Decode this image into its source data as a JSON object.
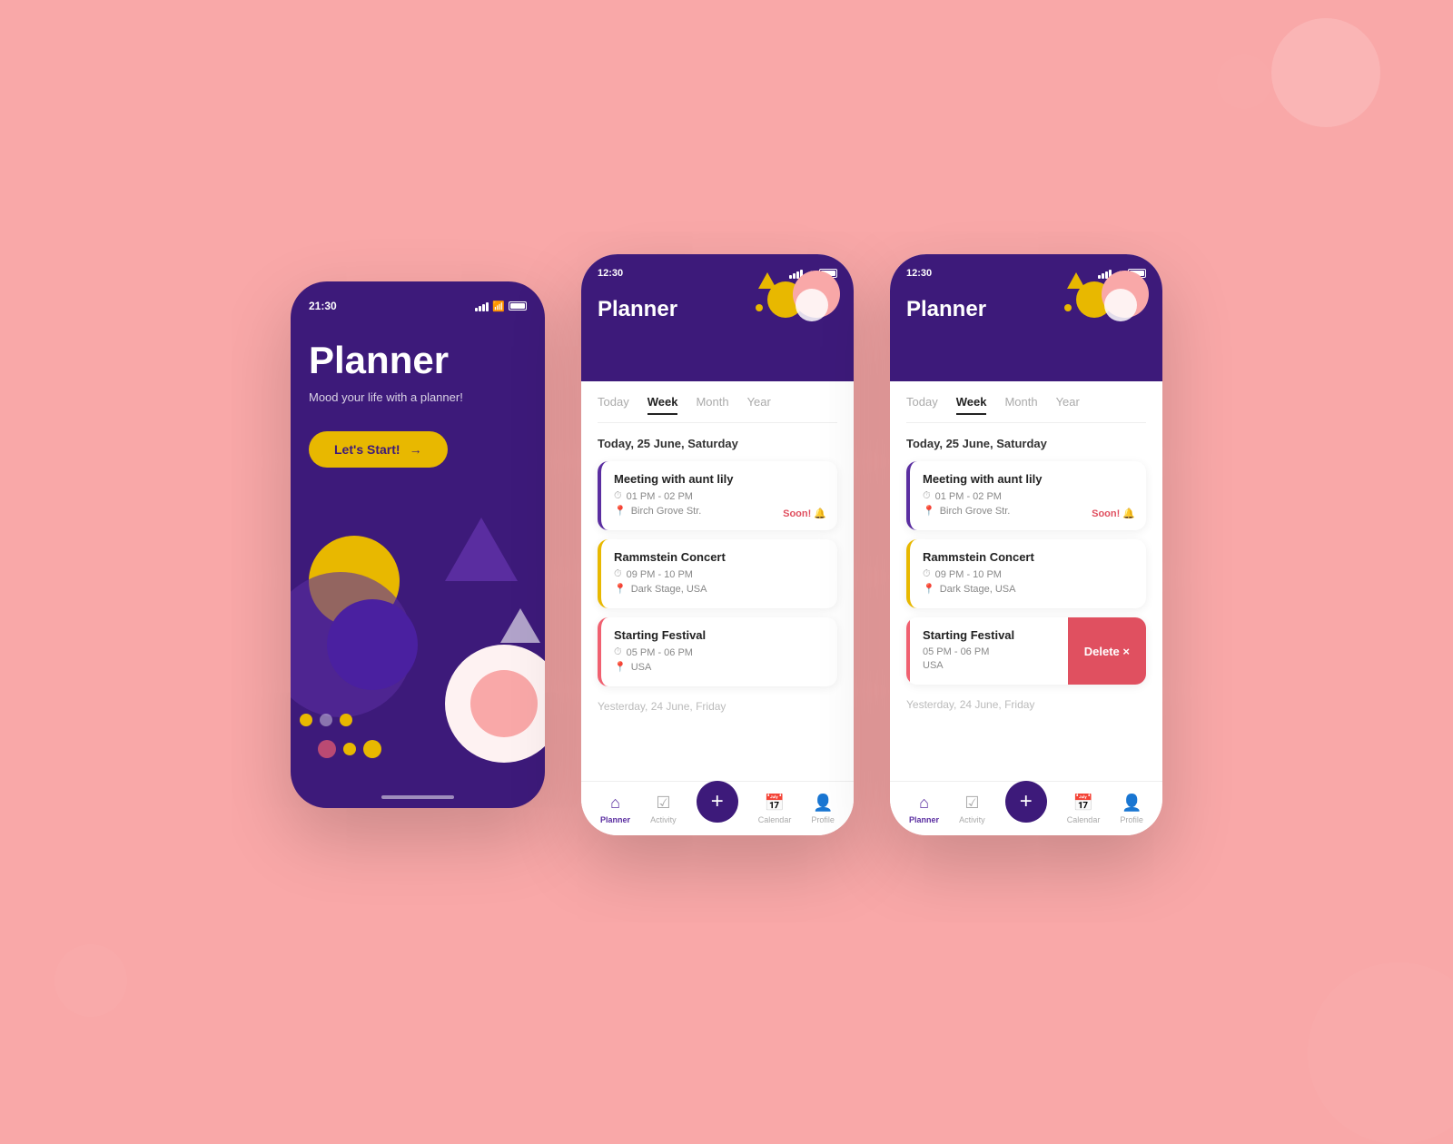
{
  "background": {
    "color": "#f9a8a8"
  },
  "phone1": {
    "status_time": "21:30",
    "title": "Planner",
    "subtitle": "Mood your life with a planner!",
    "cta_label": "Let's Start!",
    "cta_arrow": "→"
  },
  "phone2": {
    "status_time": "12:30",
    "title": "Planner",
    "tabs": [
      "Today",
      "Week",
      "Month",
      "Year"
    ],
    "active_tab": "Week",
    "date_header": "Today, 25 June, Saturday",
    "events": [
      {
        "id": 1,
        "title": "Meeting with aunt lily",
        "time": "01 PM - 02 PM",
        "location": "Birch Grove Str.",
        "border_color": "purple",
        "soon": true
      },
      {
        "id": 2,
        "title": "Rammstein Concert",
        "time": "09 PM - 10 PM",
        "location": "Dark Stage, USA",
        "border_color": "yellow",
        "soon": false
      },
      {
        "id": 3,
        "title": "Starting Festival",
        "time": "05 PM - 06 PM",
        "location": "USA",
        "border_color": "pink",
        "soon": false
      }
    ],
    "yesterday_label": "Yesterday, 24 June, Friday",
    "nav_items": [
      "Planner",
      "Activity",
      "",
      "Calendar",
      "Profile"
    ]
  },
  "phone3": {
    "status_time": "12:30",
    "title": "Planner",
    "tabs": [
      "Today",
      "Week",
      "Month",
      "Year"
    ],
    "active_tab": "Week",
    "date_header": "Today, 25 June, Saturday",
    "events": [
      {
        "id": 1,
        "title": "Meeting with aunt lily",
        "time": "01 PM - 02 PM",
        "location": "Birch Grove Str.",
        "border_color": "purple",
        "soon": true,
        "swipe": false
      },
      {
        "id": 2,
        "title": "Rammstein Concert",
        "time": "09 PM - 10 PM",
        "location": "Dark Stage, USA",
        "border_color": "yellow",
        "soon": false,
        "swipe": false
      },
      {
        "id": 3,
        "title": "Starting Festival",
        "time": "05 PM - 06 PM",
        "location": "USA",
        "border_color": "pink",
        "soon": false,
        "swipe": true,
        "delete_label": "Delete ×"
      }
    ],
    "yesterday_label": "Yesterday, 24 June, Friday",
    "nav_items": [
      "Planner",
      "Activity",
      "",
      "Calendar",
      "Profile"
    ],
    "soon_label": "Soon!"
  },
  "colors": {
    "purple_dark": "#3d1a7a",
    "purple_mid": "#5a2da0",
    "yellow": "#e8b800",
    "pink": "#f9a8a8",
    "red": "#e05060",
    "white": "#ffffff"
  }
}
